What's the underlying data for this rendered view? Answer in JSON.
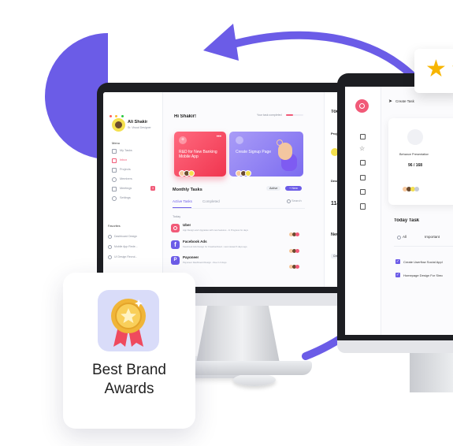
{
  "colors": {
    "accent": "#6c5ce7",
    "pink": "#f15a78",
    "deco": "#6b5ce7"
  },
  "awards": {
    "line1": "Best Brand",
    "line2": "Awards",
    "icon": "medal-icon"
  },
  "dashboard": {
    "user_name": "Ali Shakir",
    "user_role": "Sr. Visual Designer",
    "menu_title": "Menu",
    "menu_items": [
      "My Tasks",
      "Inbox",
      "Projects",
      "Members",
      "Meetings",
      "Settings"
    ],
    "meetings_badge": "3",
    "favorites_title": "Favorites",
    "favorites": [
      "Dashboard Design",
      "Mobile App Rede...",
      "UI Design Recrui..."
    ],
    "greeting": "Hi Shakir!",
    "progress_text": "Your task completed",
    "card1_title": "R&D for New Banking Mobile App",
    "card2_title": "Create Signup Page",
    "monthly_title": "Monthly Tasks",
    "active_label": "Active",
    "new_label": "+ New",
    "tab_active": "Active Tasks",
    "tab_completed": "Completed",
    "search_label": "Search",
    "today_label": "Today",
    "tasks": [
      {
        "name": "Uber",
        "desc": "App Design and Upgrades with new features - In Progress for days"
      },
      {
        "name": "Facebook Ads",
        "desc": "Facebook Ads Design for CreativeCloud - Last viewed 6 days ago"
      },
      {
        "name": "Payoneer",
        "desc": "Payoneer Dashboard Design - Due in 3 days"
      }
    ],
    "right_panel": {
      "heading": "Today",
      "new_title": "New T",
      "design": "Design",
      "project": "Project",
      "value": "114",
      "create": "Create"
    }
  },
  "app2": {
    "create_task": "Create Task",
    "card_title": "Behance Presentation",
    "card_value": "96 / 168",
    "today_task": "Today Task",
    "tab_all": "All",
    "tab_important": "Important",
    "todos": [
      "Create Userflow Social Appl",
      "Homepage Design For Simo"
    ]
  }
}
